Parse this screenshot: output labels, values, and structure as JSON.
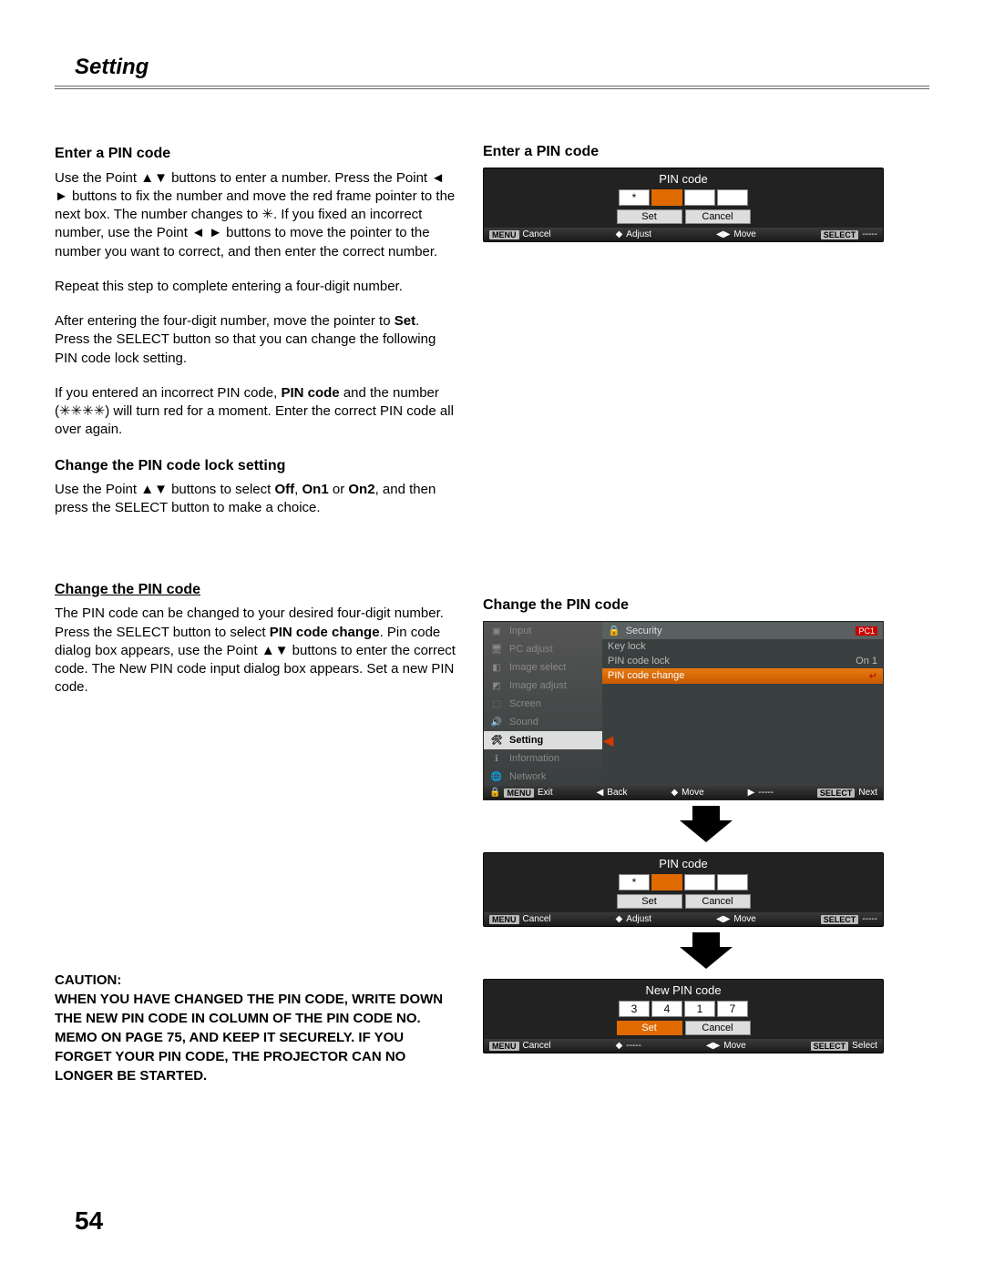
{
  "header": {
    "title": "Setting"
  },
  "page_number": "54",
  "left": {
    "h1": "Enter a PIN code",
    "p1a": "Use the Point ▲▼ buttons to enter a number. Press the Point ◄ ► buttons to fix the number and move the red frame pointer to the next box. The number changes to ",
    "p1b": "✳. If you fixed an incorrect number, use the Point ◄ ► buttons to move the pointer to the number you want to correct, and then enter the correct number.",
    "p2": "Repeat this step to complete entering a four-digit number.",
    "p3a": "After entering the four-digit number, move the pointer to ",
    "p3b": "Set",
    "p3c": ". Press the SELECT button so that you can change the following PIN code lock setting.",
    "p4a": "If you entered an incorrect PIN code, ",
    "p4b": "PIN code",
    "p4c": " and the number (✳✳✳✳) will turn red for a moment. Enter the correct PIN code all over again.",
    "h2": "Change the PIN code lock setting",
    "p5a": "Use the Point ▲▼ buttons to select ",
    "p5b": "Off",
    "p5c": ", ",
    "p5d": "On1",
    "p5e": " or ",
    "p5f": "On2",
    "p5g": ", and then press the SELECT button to make a choice.",
    "h3": "Change the PIN code",
    "p6a": "The PIN code can be changed to your desired four-digit number. Press the SELECT button to select ",
    "p6b": "PIN code change",
    "p6c": ". Pin code dialog box appears, use the Point ▲▼ buttons to enter the correct code. The New PIN code input dialog box appears. Set a new PIN code.",
    "caution_label": "CAUTION:",
    "caution_body": "WHEN YOU HAVE CHANGED THE PIN CODE, WRITE DOWN THE NEW PIN CODE IN COLUMN OF THE PIN CODE NO. MEMO ON PAGE 75, AND KEEP IT SECURELY. IF YOU FORGET YOUR PIN CODE, THE PROJECTOR CAN NO LONGER BE STARTED."
  },
  "right": {
    "label1": "Enter a PIN code",
    "label2": "Change the PIN code"
  },
  "pin1": {
    "title": "PIN code",
    "cells": [
      "*",
      "",
      "",
      ""
    ],
    "set": "Set",
    "cancel": "Cancel",
    "bar": {
      "menu": "MENU",
      "cancel": "Cancel",
      "adjust": "Adjust",
      "move": "Move",
      "select": "SELECT",
      "dash": "-----"
    }
  },
  "osd": {
    "side": [
      "Input",
      "PC adjust",
      "Image select",
      "Image adjust",
      "Screen",
      "Sound",
      "Setting",
      "Information",
      "Network"
    ],
    "head": {
      "ic": "🔒",
      "title": "Security",
      "badge": "PC1"
    },
    "rows": [
      {
        "label": "Key lock",
        "val": ""
      },
      {
        "label": "PIN code lock",
        "val": "On 1"
      },
      {
        "label": "PIN code change",
        "val": ""
      }
    ],
    "bar": {
      "menu": "MENU",
      "exit": "Exit",
      "back": "Back",
      "move": "Move",
      "dash": "-----",
      "select": "SELECT",
      "next": "Next"
    }
  },
  "pin2": {
    "title": "PIN code",
    "cells": [
      "*",
      "",
      "",
      ""
    ],
    "set": "Set",
    "cancel": "Cancel",
    "bar": {
      "menu": "MENU",
      "cancel": "Cancel",
      "adjust": "Adjust",
      "move": "Move",
      "select": "SELECT",
      "dash": "-----"
    }
  },
  "pin3": {
    "title": "New PIN code",
    "cells": [
      "3",
      "4",
      "1",
      "7"
    ],
    "set": "Set",
    "cancel": "Cancel",
    "bar": {
      "menu": "MENU",
      "cancel": "Cancel",
      "dash": "-----",
      "move": "Move",
      "select": "SELECT",
      "sel": "Select"
    }
  }
}
